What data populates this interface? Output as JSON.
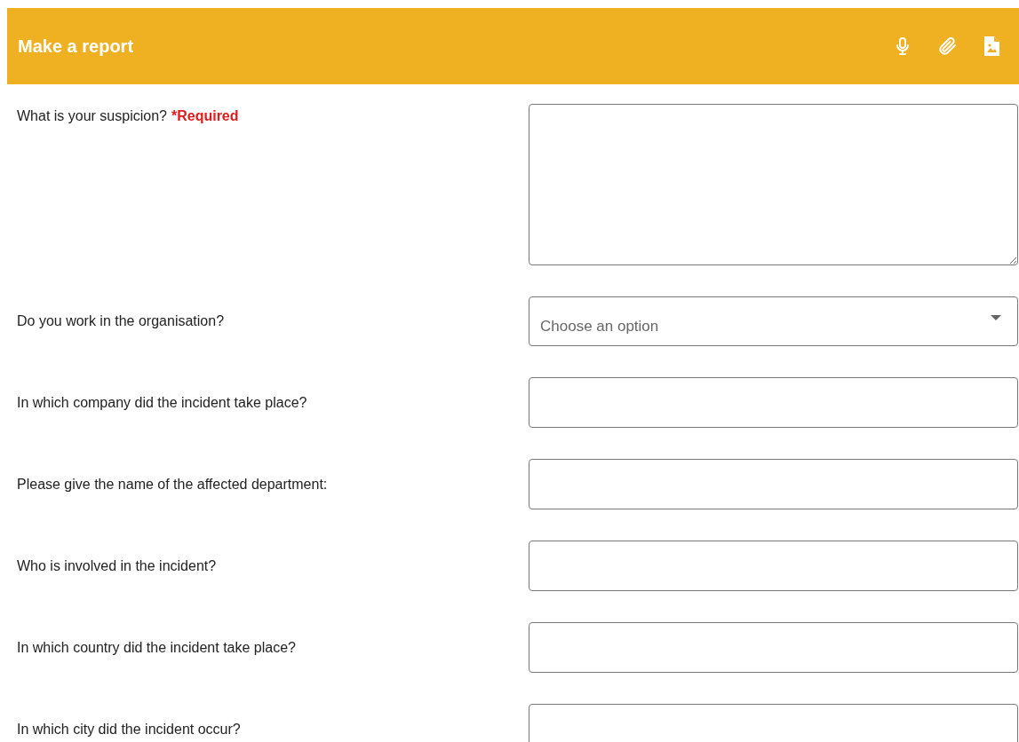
{
  "header": {
    "title": "Make a report"
  },
  "questions": [
    {
      "label": "What is your suspicion?",
      "required_note": "*Required",
      "kind": "textarea"
    },
    {
      "label": "Do you work in the organisation?",
      "kind": "select",
      "placeholder": "Choose an option"
    },
    {
      "label": "In which company did the incident take place?",
      "kind": "input"
    },
    {
      "label": "Please give the name of the affected department:",
      "kind": "input"
    },
    {
      "label": "Who is involved in the incident?",
      "kind": "input"
    },
    {
      "label": "In which country did the incident take place?",
      "kind": "input"
    },
    {
      "label": "In which city did the incident occur?",
      "kind": "input"
    }
  ]
}
